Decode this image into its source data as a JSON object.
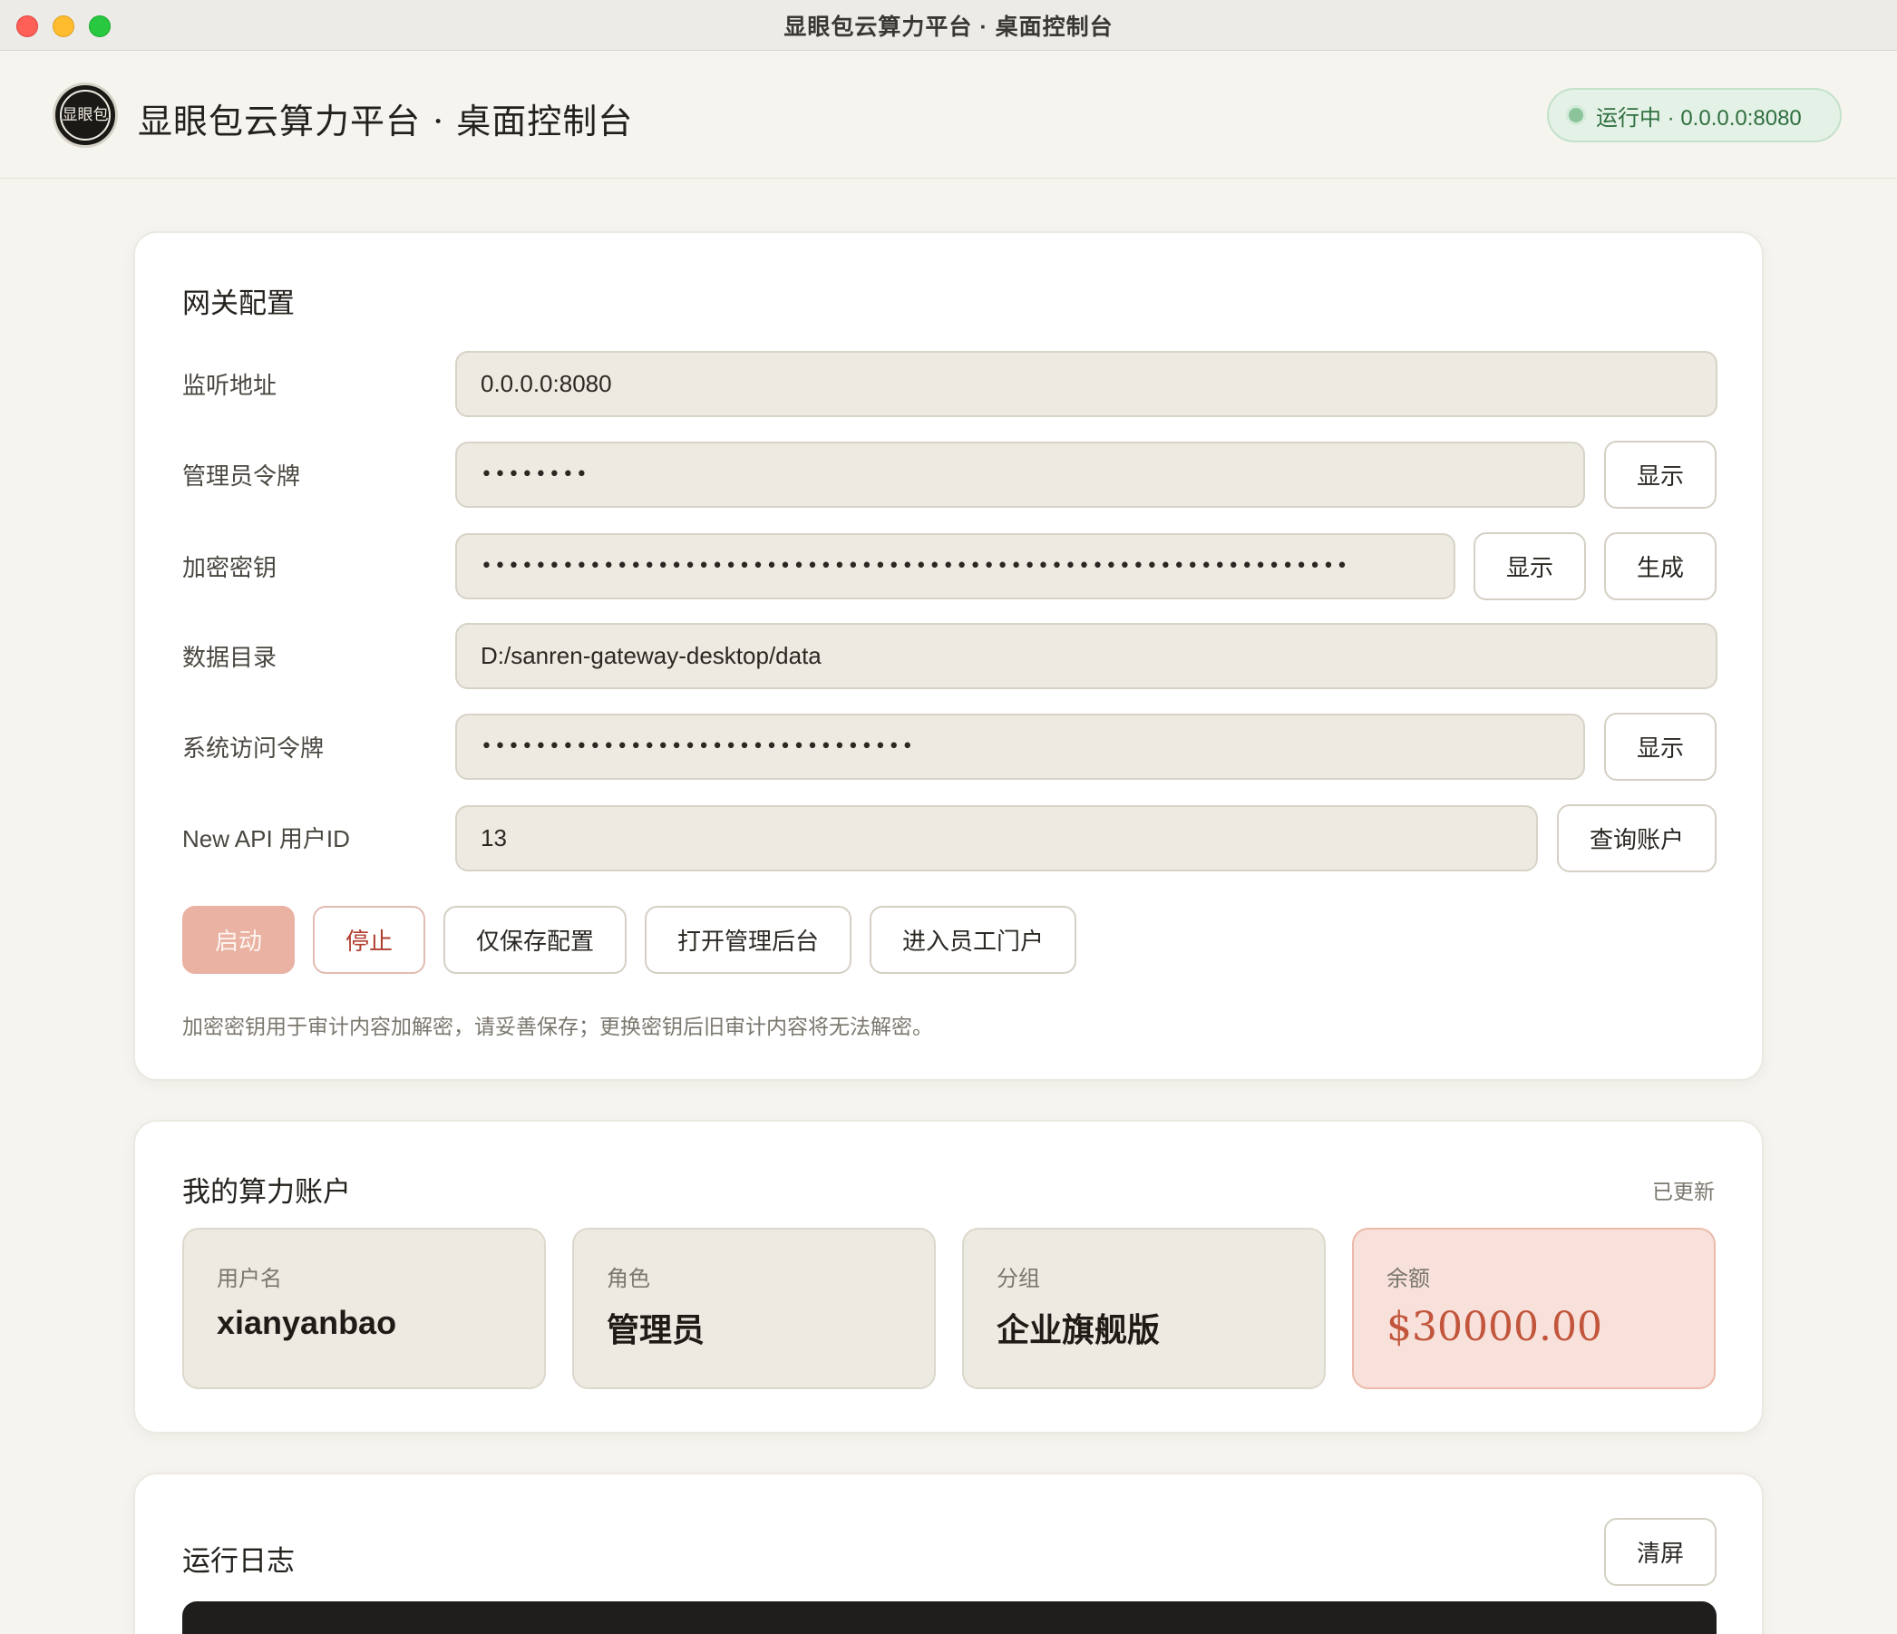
{
  "window": {
    "title": "显眼包云算力平台 · 桌面控制台"
  },
  "header": {
    "logo_text": "显眼包",
    "title": "显眼包云算力平台 · 桌面控制台",
    "status": "运行中 · 0.0.0.0:8080"
  },
  "gateway": {
    "title": "网关配置",
    "listen_label": "监听地址",
    "listen_value": "0.0.0.0:8080",
    "admin_token_label": "管理员令牌",
    "admin_token_value": "••••••••",
    "admin_token_show": "显示",
    "encrypt_key_label": "加密密钥",
    "encrypt_key_value": "••••••••••••••••••••••••••••••••••••••••••••••••••••••••••••••••",
    "encrypt_key_show": "显示",
    "encrypt_key_generate": "生成",
    "data_dir_label": "数据目录",
    "data_dir_value": "D:/sanren-gateway-desktop/data",
    "system_token_label": "系统访问令牌",
    "system_token_value": "••••••••••••••••••••••••••••••••",
    "system_token_show": "显示",
    "user_id_label": "New API 用户ID",
    "user_id_value": "13",
    "query_account": "查询账户",
    "actions": {
      "start": "启动",
      "stop": "停止",
      "save_only": "仅保存配置",
      "open_admin": "打开管理后台",
      "enter_portal": "进入员工门户"
    },
    "hint": "加密密钥用于审计内容加解密，请妥善保存；更换密钥后旧审计内容将无法解密。"
  },
  "account": {
    "title": "我的算力账户",
    "updated": "已更新",
    "username_label": "用户名",
    "username_value": "xianyanbao",
    "role_label": "角色",
    "role_value": "管理员",
    "group_label": "分组",
    "group_value": "企业旗舰版",
    "balance_label": "余额",
    "balance_value": "$30000.00"
  },
  "logs": {
    "title": "运行日志",
    "clear": "清屏"
  },
  "colors": {
    "accent": "#e9b2a3",
    "danger": "#b13d2f",
    "status_green": "#2f6f3f",
    "balance": "#c2553b"
  }
}
